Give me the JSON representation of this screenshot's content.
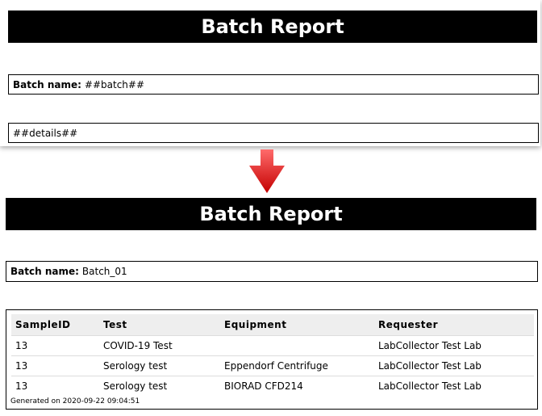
{
  "template": {
    "title": "Batch Report",
    "batch_label": "Batch name:",
    "batch_value": "##batch##",
    "details_value": "##details##"
  },
  "result": {
    "title": "Batch Report",
    "batch_label": "Batch name:",
    "batch_value": "Batch_01",
    "columns": [
      "SampleID",
      "Test",
      "Equipment",
      "Requester"
    ],
    "rows": [
      [
        "13",
        "COVID-19 Test",
        "",
        "LabCollector Test Lab"
      ],
      [
        "13",
        "Serology test",
        "Eppendorf Centrifuge",
        "LabCollector Test Lab"
      ],
      [
        "13",
        "Serology test",
        "BIORAD CFD214",
        "LabCollector Test Lab"
      ]
    ],
    "generated": "Generated on 2020-09-22 09:04:51"
  },
  "colors": {
    "banner": "#000000",
    "arrow_top": "#ff4a4a",
    "arrow_bottom": "#c40000",
    "header_bg": "#eeeeee"
  },
  "icons": {
    "arrow": "arrow-down-icon"
  }
}
